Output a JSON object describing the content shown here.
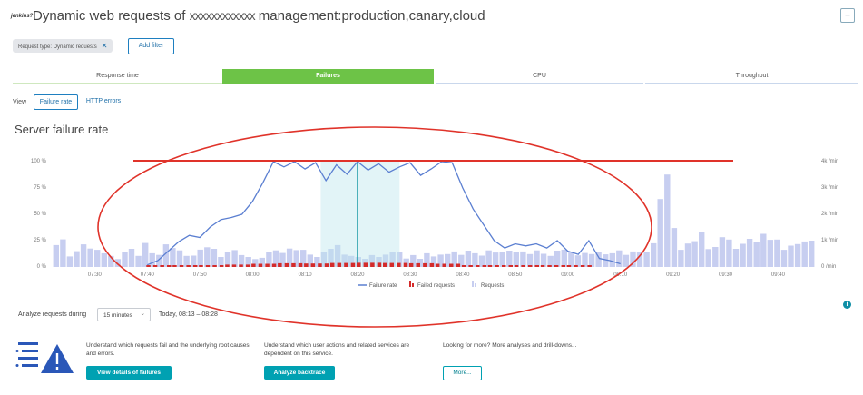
{
  "header": {
    "logo_text": "jenkins?",
    "title_prefix": "Dynamic web requests of ",
    "redacted": "xxxxxxxxxxxx",
    "title_suffix": " management:production,canary,cloud",
    "corner_button": "–"
  },
  "filters": {
    "chip_label": "Request type: Dynamic requests",
    "chip_close": "✕",
    "add_filter": "Add filter"
  },
  "tabs": [
    {
      "label": "Response time",
      "active": false
    },
    {
      "label": "Failures",
      "active": true
    },
    {
      "label": "CPU",
      "active": false
    },
    {
      "label": "Throughput",
      "active": false
    }
  ],
  "view": {
    "label": "View",
    "options": [
      {
        "label": "Failure rate",
        "selected": true
      },
      {
        "label": "HTTP errors",
        "selected": false
      }
    ]
  },
  "section_title": "Server failure rate",
  "chart_data": {
    "type": "bar",
    "title": "Server failure rate",
    "y_left_ticks": [
      "100 %",
      "75 %",
      "50 %",
      "25 %",
      "0 %"
    ],
    "y_right_ticks": [
      "4k /min",
      "3k /min",
      "2k /min",
      "1k /min",
      "0 /min"
    ],
    "x_ticks": [
      "07:30",
      "07:40",
      "07:50",
      "08:00",
      "08:10",
      "08:20",
      "08:30",
      "08:40",
      "08:50",
      "09:00",
      "09:10",
      "09:20",
      "09:30",
      "09:40"
    ],
    "ylim_left": [
      0,
      100
    ],
    "ylim_right": [
      0,
      4000
    ],
    "selected_range": [
      "08:13",
      "08:28"
    ],
    "legend": [
      "Failure rate",
      "Failed requests",
      "Requests"
    ],
    "series": [
      {
        "name": "Failure rate",
        "color": "#5b7fd1",
        "x": [
          "07:40",
          "07:42",
          "07:44",
          "07:46",
          "07:48",
          "07:50",
          "07:52",
          "07:54",
          "07:56",
          "07:58",
          "08:00",
          "08:02",
          "08:04",
          "08:06",
          "08:08",
          "08:10",
          "08:12",
          "08:14",
          "08:16",
          "08:18",
          "08:20",
          "08:22",
          "08:24",
          "08:26",
          "08:28",
          "08:30",
          "08:32",
          "08:34",
          "08:36",
          "08:38",
          "08:40",
          "08:42",
          "08:44",
          "08:46",
          "08:48",
          "08:50",
          "08:52",
          "08:54",
          "08:56",
          "08:58",
          "09:00",
          "09:02",
          "09:04",
          "09:06",
          "09:08",
          "09:10"
        ],
        "values": [
          2,
          6,
          15,
          24,
          30,
          28,
          38,
          45,
          47,
          50,
          62,
          80,
          100,
          95,
          100,
          93,
          99,
          82,
          97,
          88,
          100,
          92,
          98,
          90,
          95,
          99,
          87,
          93,
          100,
          99,
          75,
          55,
          40,
          25,
          18,
          22,
          20,
          22,
          18,
          25,
          15,
          12,
          25,
          8,
          6,
          3
        ]
      },
      {
        "name": "Requests",
        "color": "#c7cef0",
        "unit": "/min",
        "values": [
          830,
          1050,
          400,
          600,
          860,
          700,
          650,
          520,
          420,
          300,
          560,
          690,
          420,
          910,
          520,
          460,
          860,
          720,
          630,
          420,
          430,
          660,
          750,
          690,
          380,
          560,
          640,
          450,
          380,
          300,
          350,
          560,
          630,
          530,
          700,
          640,
          650,
          470,
          380,
          560,
          690,
          830,
          470,
          420,
          380,
          310,
          450,
          380,
          470,
          560,
          560,
          320,
          450,
          310,
          520,
          400,
          470,
          490,
          590,
          460,
          620,
          520,
          430,
          630,
          550,
          570,
          620,
          560,
          590,
          490,
          630,
          500,
          420,
          620,
          660,
          570,
          440,
          530,
          490,
          580,
          480,
          520,
          630,
          460,
          590,
          560,
          560,
          900,
          2580,
          3510,
          1480,
          650,
          890,
          980,
          1320,
          680,
          760,
          1130,
          1040,
          690,
          880,
          1070,
          960,
          1260,
          1030,
          1040,
          650,
          810,
          870,
          970,
          1000
        ]
      },
      {
        "name": "Failed requests",
        "color": "#d42b2b",
        "unit": "/min",
        "x": [
          "07:40",
          "07:45",
          "07:50",
          "07:55",
          "08:00",
          "08:05",
          "08:10",
          "08:15",
          "08:20",
          "08:25",
          "08:30",
          "08:35",
          "08:40",
          "08:45",
          "08:50",
          "08:55",
          "09:00"
        ],
        "values": [
          20,
          40,
          60,
          90,
          120,
          140,
          130,
          150,
          160,
          150,
          140,
          120,
          70,
          40,
          30,
          20,
          10
        ]
      }
    ]
  },
  "analyze": {
    "label": "Analyze requests during",
    "dropdown_value": "15 minutes",
    "dropdown_chevron": "⌄",
    "range_text": "Today, 08:13 – 08:28"
  },
  "cards": [
    {
      "text": "Understand which requests fail and the underlying root causes and errors.",
      "button": "View details of failures"
    },
    {
      "text": "Understand which user actions and related services are dependent on this service.",
      "button": "Analyze backtrace"
    },
    {
      "text": "Looking for more? More analyses and drill-downs...",
      "button": "More..."
    }
  ],
  "info_icon": "i",
  "annotation": {
    "circle_color": "#e0332a",
    "line_color": "#e0332a"
  }
}
